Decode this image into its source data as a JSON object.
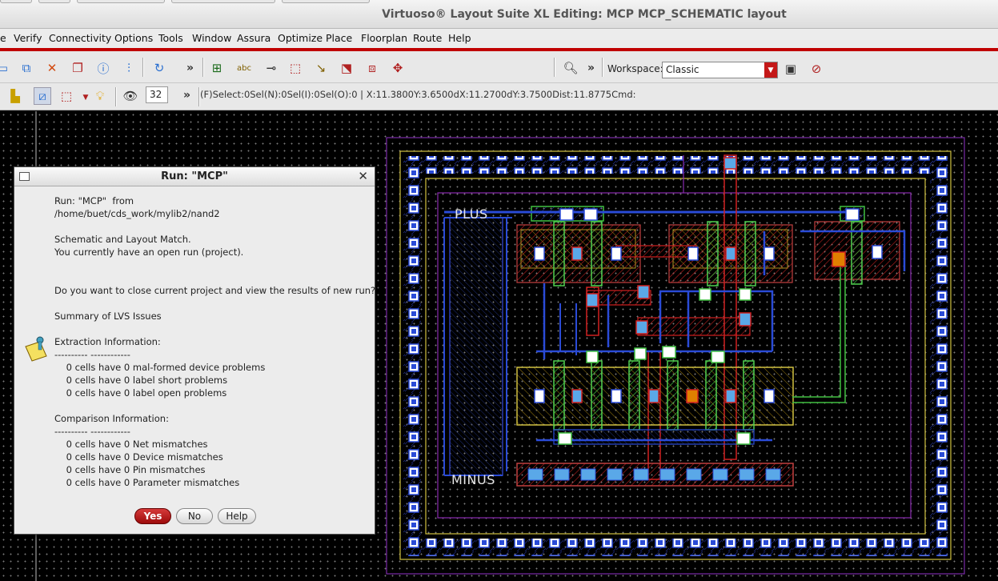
{
  "window": {
    "title": "Virtuoso® Layout Suite XL Editing: MCP MCP_SCHEMATIC layout"
  },
  "menu": [
    "e",
    "Verify",
    "Connectivity",
    "Options",
    "Tools",
    "Window",
    "Assura",
    "Optimize",
    "Place",
    "Floorplan",
    "Route",
    "Help"
  ],
  "toolbar": {
    "workspace_label": "Workspace:",
    "workspace_value": "Classic",
    "spin_value": "32",
    "status": "(F)Select:0Sel(N):0Sel(I):0Sel(O):0 | X:11.3800Y:3.6500dX:11.2700dY:3.7500Dist:11.8775Cmd:"
  },
  "layout": {
    "plus_label": "PLUS",
    "minus_label": "MINUS"
  },
  "dialog": {
    "title": "Run: \"MCP\"",
    "body_lines": [
      "Run: \"MCP\"  from",
      "/home/buet/cds_work/mylib2/nand2",
      "",
      "Schematic and Layout Match.",
      "You currently have an open run (project).",
      "",
      "",
      "Do you want to close current project and view the results of new run?",
      "",
      "Summary of LVS Issues",
      "",
      "Extraction Information:",
      "---------- ------------",
      "    0 cells have 0 mal-formed device problems",
      "    0 cells have 0 label short problems",
      "    0 cells have 0 label open problems",
      "",
      "Comparison Information:",
      "---------- ------------",
      "    0 cells have 0 Net mismatches",
      "    0 cells have 0 Device mismatches",
      "    0 cells have 0 Pin mismatches",
      "    0 cells have 0 Parameter mismatches"
    ],
    "yes": "Yes",
    "no": "No",
    "help": "Help"
  },
  "colors": {
    "accent": "#c00000",
    "metal1": "#2a4bd7",
    "poly": "#d42020",
    "active": "#44c844",
    "contact": "#5aa8e8"
  }
}
